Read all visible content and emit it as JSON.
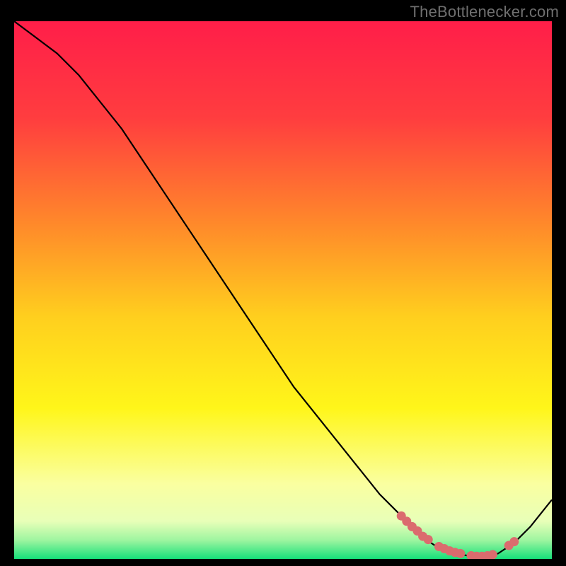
{
  "attribution": "TheBottlenecker.com",
  "chart_data": {
    "type": "line",
    "title": "",
    "xlabel": "",
    "ylabel": "",
    "xlim": [
      0,
      100
    ],
    "ylim": [
      0,
      100
    ],
    "series": [
      {
        "name": "curve",
        "x": [
          0,
          4,
          8,
          12,
          16,
          20,
          24,
          28,
          32,
          36,
          40,
          44,
          48,
          52,
          56,
          60,
          64,
          68,
          72,
          73,
          76,
          79,
          82,
          85,
          88,
          90,
          93,
          96,
          100
        ],
        "y": [
          100,
          97,
          94,
          90,
          85,
          80,
          74,
          68,
          62,
          56,
          50,
          44,
          38,
          32,
          27,
          22,
          17,
          12,
          8,
          7,
          4,
          2,
          1,
          0.5,
          0.5,
          1,
          3,
          6,
          11
        ]
      }
    ],
    "markers": {
      "name": "highlight-dots",
      "x": [
        72,
        73,
        74,
        75,
        76,
        77,
        79,
        80,
        81,
        82,
        83,
        85,
        86,
        87,
        88,
        89,
        92,
        93
      ],
      "y": [
        8,
        7,
        6,
        5.2,
        4.2,
        3.6,
        2.3,
        1.9,
        1.5,
        1.2,
        1.0,
        0.6,
        0.5,
        0.5,
        0.6,
        0.8,
        2.5,
        3.2
      ]
    },
    "gradient_stops": [
      {
        "offset": 0.0,
        "color": "#ff1e49"
      },
      {
        "offset": 0.18,
        "color": "#ff3d3f"
      },
      {
        "offset": 0.38,
        "color": "#ff8a2a"
      },
      {
        "offset": 0.55,
        "color": "#ffcf1e"
      },
      {
        "offset": 0.72,
        "color": "#fff61a"
      },
      {
        "offset": 0.86,
        "color": "#faffa0"
      },
      {
        "offset": 0.93,
        "color": "#e8ffb8"
      },
      {
        "offset": 0.965,
        "color": "#9ef5a0"
      },
      {
        "offset": 1.0,
        "color": "#16e07a"
      }
    ],
    "marker_color": "#db6b6e",
    "line_color": "#000000"
  }
}
